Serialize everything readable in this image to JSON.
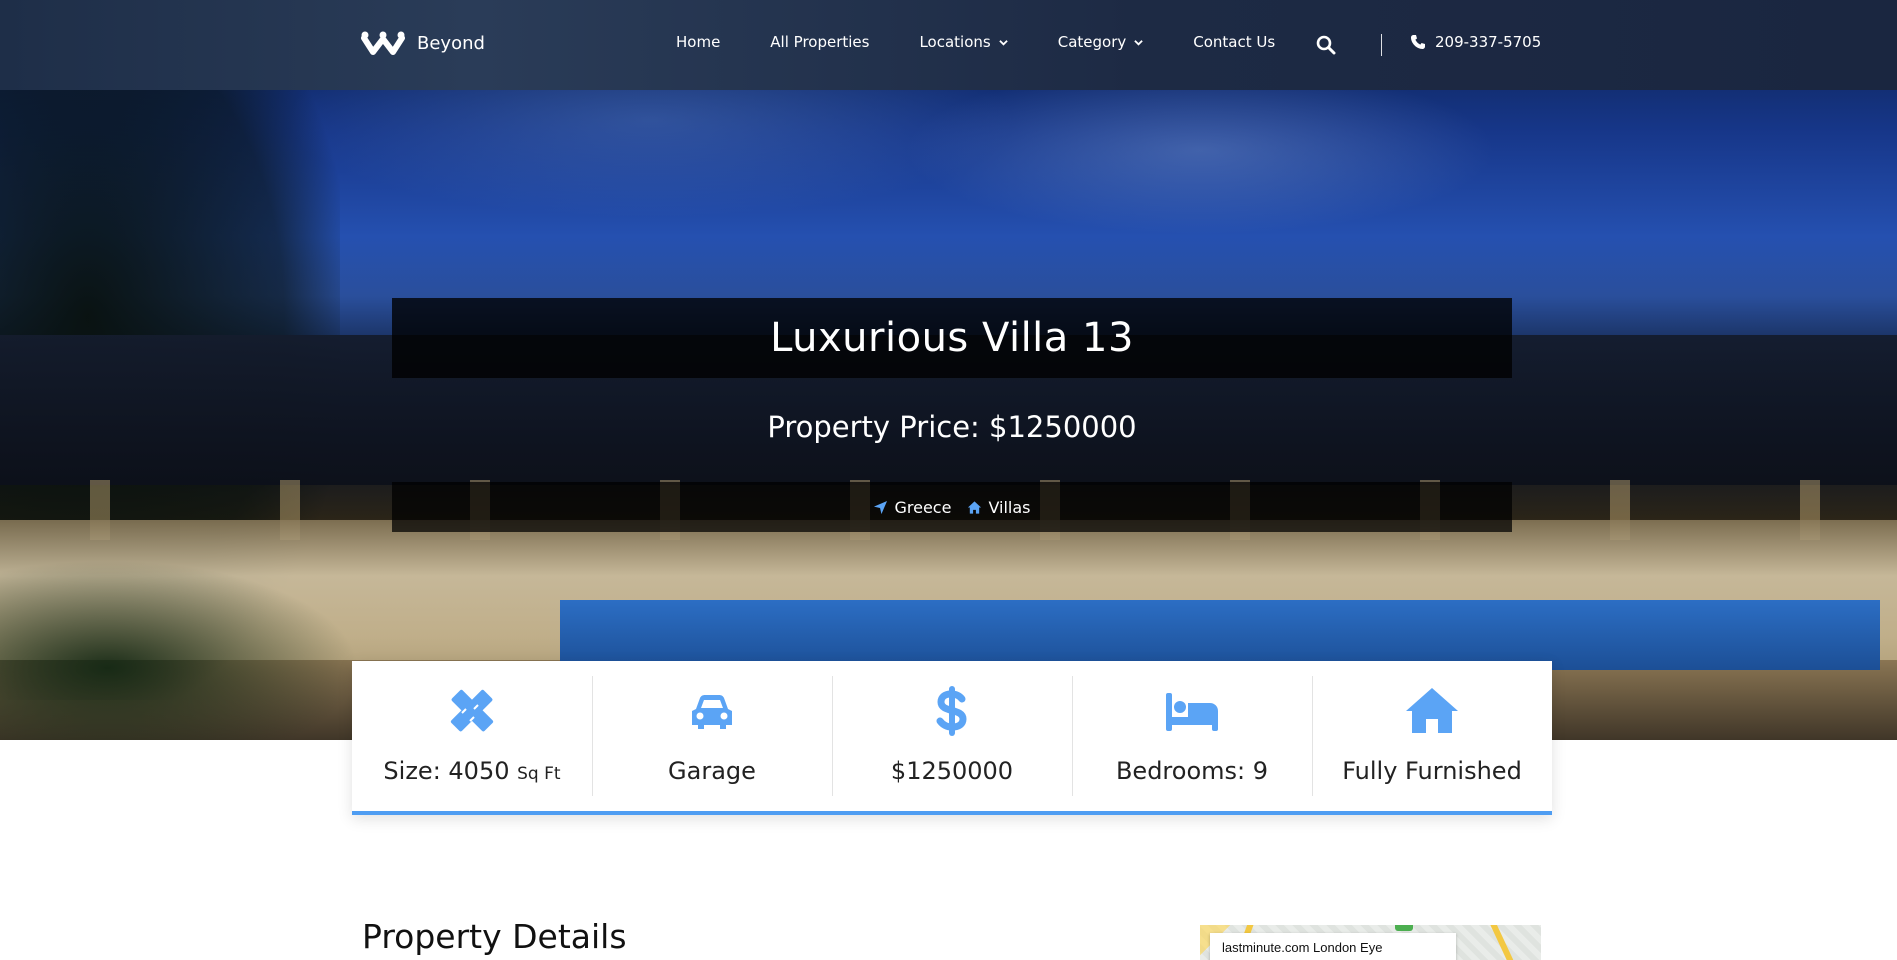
{
  "navbar": {
    "brand": "Beyond",
    "links": [
      {
        "label": "Home"
      },
      {
        "label": "All Properties"
      },
      {
        "label": "Locations"
      },
      {
        "label": "Category"
      },
      {
        "label": "Contact Us"
      }
    ],
    "phone": "209-337-5705"
  },
  "hero": {
    "title": "Luxurious Villa 13",
    "price": "Property Price: $1250000",
    "location": "Greece",
    "category": "Villas"
  },
  "features": [
    {
      "icon": "pencil-ruler-icon",
      "label": "Size: 4050",
      "unit": "Sq Ft"
    },
    {
      "icon": "car-icon",
      "label": "Garage"
    },
    {
      "icon": "dollar-icon",
      "label": "$1250000"
    },
    {
      "icon": "bed-icon",
      "label": "Bedrooms: 9"
    },
    {
      "icon": "home-icon",
      "label": "Fully Furnished"
    }
  ],
  "details": {
    "title": "Property Details",
    "map_place": "lastminute.com London Eye"
  },
  "colors": {
    "accent": "#4f9df2",
    "icon_blue": "#5ba4f5",
    "navbar": "#1e2e48"
  }
}
